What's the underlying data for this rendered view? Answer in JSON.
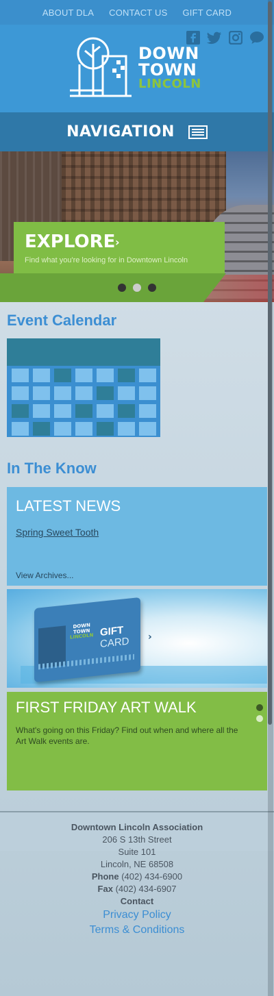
{
  "topnav": {
    "about": "ABOUT DLA",
    "contact": "CONTACT US",
    "gift": "GIFT CARD"
  },
  "social": [
    "facebook-icon",
    "twitter-icon",
    "instagram-icon",
    "chat-icon"
  ],
  "logo": {
    "line1": "DOWN",
    "line2": "TOWN",
    "line3": "LINCOLN"
  },
  "nav": {
    "label": "NAVIGATION"
  },
  "hero": {
    "title": "EXPLORE",
    "chevron": "›",
    "subtitle": "Find what you're looking for in Downtown Lincoln",
    "active_slide": 2,
    "slides": 3
  },
  "events": {
    "title": "Event Calendar"
  },
  "know": {
    "title": "In The Know"
  },
  "news": {
    "title": "LATEST NEWS",
    "item": "Spring Sweet Tooth",
    "archives": "View Archives..."
  },
  "giftcard": {
    "gift": "GIFT",
    "card": "CARD",
    "logo1": "DOWN",
    "logo2": "TOWN",
    "logo3": "LINCOLN",
    "chevron": "›"
  },
  "artwalk": {
    "title": "FIRST FRIDAY ART WALK",
    "desc": "What's going on this Friday? Find out when and where all the Art Walk events are."
  },
  "footer": {
    "org": "Downtown Lincoln Association",
    "address1": "206 S 13th Street",
    "address2": "Suite 101",
    "city": "Lincoln, NE 68508",
    "phone_label": "Phone",
    "phone": "(402) 434-6900",
    "fax_label": "Fax",
    "fax": "(402) 434-6907",
    "contact": "Contact",
    "privacy": "Privacy Policy",
    "terms": "Terms & Conditions"
  },
  "colors": {
    "topbar": "#3b8fcc",
    "header": "#3d98d6",
    "navbar": "#2f78a8",
    "green": "#82bd46",
    "blue": "#6db9e2",
    "title_blue": "#3c8ed3"
  }
}
